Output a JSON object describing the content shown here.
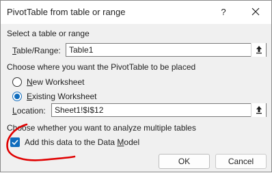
{
  "dialog": {
    "title": "PivotTable from table or range",
    "help_label": "?",
    "close_icon": "close-icon"
  },
  "table_section": {
    "heading": "Select a table or range",
    "label_underlined": "T",
    "label_rest": "able/Range:",
    "value": "Table1",
    "ref_icon": "collapse-dialog-icon"
  },
  "placement_section": {
    "heading": "Choose where you want the PivotTable to be placed",
    "options": [
      {
        "underlined": "N",
        "rest": "ew Worksheet",
        "selected": false
      },
      {
        "underlined": "E",
        "rest": "xisting Worksheet",
        "selected": true
      }
    ],
    "location_underlined": "L",
    "location_rest": "ocation:",
    "location_value": "Sheet1!$I$12",
    "ref_icon": "collapse-dialog-icon"
  },
  "multi_section": {
    "heading": "Choose whether you want to analyze multiple tables",
    "checkbox_pre": "Add this data to the Data ",
    "checkbox_underlined": "M",
    "checkbox_post": "odel",
    "checked": true
  },
  "buttons": {
    "ok": "OK",
    "cancel": "Cancel"
  },
  "colors": {
    "accent": "#0f6cbd",
    "annotation": "#e00000"
  }
}
